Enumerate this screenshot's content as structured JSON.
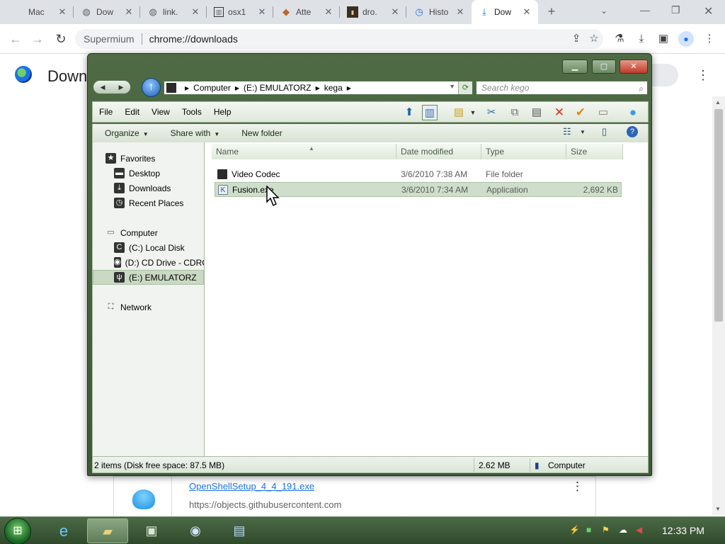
{
  "browser": {
    "tabs": [
      {
        "label": "Mac",
        "icon": "apple-icon",
        "active": false
      },
      {
        "label": "Dow",
        "icon": "globe-icon",
        "active": false
      },
      {
        "label": "link.",
        "icon": "globe-icon",
        "active": false
      },
      {
        "label": "osx1",
        "icon": "site-icon",
        "active": false
      },
      {
        "label": "Atte",
        "icon": "site-icon",
        "active": false
      },
      {
        "label": "dro.",
        "icon": "terminal-icon",
        "active": false
      },
      {
        "label": "Histo",
        "icon": "history-icon",
        "active": false
      },
      {
        "label": "Dow",
        "icon": "download-icon",
        "active": true
      }
    ],
    "omnibox": {
      "brand": "Supermium",
      "url": "chrome://downloads"
    }
  },
  "downloads_page": {
    "title": "Down",
    "item": {
      "file_name": "OpenShellSetup_4_4_191.exe",
      "source_url": "https://objects.githubusercontent.com"
    }
  },
  "explorer": {
    "breadcrumb": [
      "Computer",
      "(E:) EMULATORZ",
      "kega"
    ],
    "search_placeholder": "Search kego",
    "menu": [
      "File",
      "Edit",
      "View",
      "Tools",
      "Help"
    ],
    "commands": {
      "organize": "Organize",
      "share_with": "Share with",
      "new_folder": "New folder"
    },
    "nav": {
      "favorites": "Favorites",
      "favorites_items": [
        "Desktop",
        "Downloads",
        "Recent Places"
      ],
      "computer": "Computer",
      "drives": [
        "(C:) Local Disk",
        "(D:) CD Drive - CDRC",
        "(E:) EMULATORZ"
      ],
      "network": "Network"
    },
    "columns": {
      "name": "Name",
      "date": "Date modified",
      "type": "Type",
      "size": "Size"
    },
    "files": [
      {
        "name": "Video Codec",
        "date": "3/6/2010 7:38 AM",
        "type": "File folder",
        "size": ""
      },
      {
        "name": "Fusion.exe",
        "date": "3/6/2010 7:34 AM",
        "type": "Application",
        "size": "2,692 KB"
      }
    ],
    "status": {
      "items": "2 items (Disk free space: 87.5 MB)",
      "size": "2.62 MB",
      "location": "Computer"
    }
  },
  "taskbar": {
    "clock": "12:33 PM"
  }
}
